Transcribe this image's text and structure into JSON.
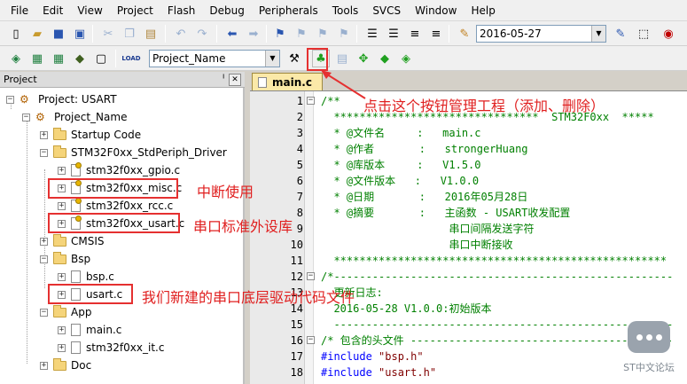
{
  "menu": [
    "File",
    "Edit",
    "View",
    "Project",
    "Flash",
    "Debug",
    "Peripherals",
    "Tools",
    "SVCS",
    "Window",
    "Help"
  ],
  "toolbar": {
    "date_value": "2016-05-27",
    "target_value": "Project_Name",
    "load_label": "LOAD"
  },
  "project_panel": {
    "title": "Project",
    "pin": "ᅵ",
    "close": "✕",
    "tree": {
      "root": "Project: USART",
      "target": "Project_Name",
      "startup": "Startup Code",
      "driver_group": "STM32F0xx_StdPeriph_Driver",
      "driver_files": [
        "stm32f0xx_gpio.c",
        "stm32f0xx_misc.c",
        "stm32f0xx_rcc.c",
        "stm32f0xx_usart.c"
      ],
      "cmsis": "CMSIS",
      "bsp_group": "Bsp",
      "bsp_files": [
        "bsp.c",
        "usart.c"
      ],
      "app_group": "App",
      "app_files": [
        "main.c",
        "stm32f0xx_it.c"
      ],
      "doc": "Doc"
    }
  },
  "annotations": {
    "button_note": "点击这个按钮管理工程（添加、删除）",
    "misc_note": "中断使用",
    "usart_lib_note": "串口标准外设库",
    "usart_driver_note": "我们新建的串口底层驱动代码文件"
  },
  "editor": {
    "tab": "main.c",
    "lines": [
      {
        "n": "1",
        "fold": "−",
        "text": "/**"
      },
      {
        "n": "2",
        "fold": "",
        "text": "  ********************************  STM32F0xx  *****"
      },
      {
        "n": "3",
        "fold": "",
        "text": "  * @文件名     :   main.c"
      },
      {
        "n": "4",
        "fold": "",
        "text": "  * @作者       :   strongerHuang"
      },
      {
        "n": "5",
        "fold": "",
        "text": "  * @库版本     :   V1.5.0"
      },
      {
        "n": "6",
        "fold": "",
        "text": "  * @文件版本   :   V1.0.0"
      },
      {
        "n": "7",
        "fold": "",
        "text": "  * @日期       :   2016年05月28日"
      },
      {
        "n": "8",
        "fold": "",
        "text": "  * @摘要       :   主函数 - USART收发配置"
      },
      {
        "n": "9",
        "fold": "",
        "text": "                    串口间隔发送字符"
      },
      {
        "n": "10",
        "fold": "",
        "text": "                    串口中断接收"
      },
      {
        "n": "11",
        "fold": "",
        "text": "  ****************************************************"
      },
      {
        "n": "12",
        "fold": "−",
        "text": "/*-----------------------------------------------------"
      },
      {
        "n": "13",
        "fold": "",
        "text": "  更新日志:"
      },
      {
        "n": "14",
        "fold": "",
        "text": "  2016-05-28 V1.0.0:初始版本"
      },
      {
        "n": "15",
        "fold": "",
        "text": "  -----------------------------------------------------"
      },
      {
        "n": "16",
        "fold": "−",
        "text": "/* 包含的头文件 -----------------------------------------"
      },
      {
        "n": "17",
        "fold": "",
        "text": "#include \"bsp.h\""
      },
      {
        "n": "18",
        "fold": "",
        "text": "#include \"usart.h\""
      },
      {
        "n": "19",
        "fold": "",
        "text": ""
      }
    ]
  },
  "watermark": "ST中文论坛"
}
